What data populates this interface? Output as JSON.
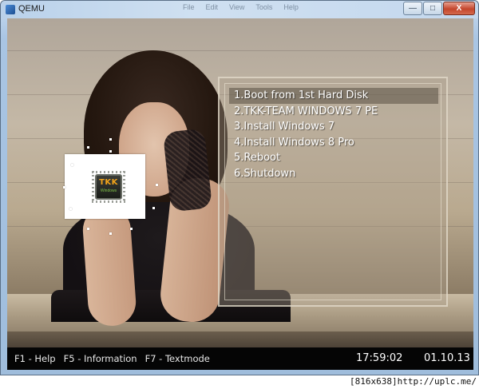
{
  "window": {
    "title": "QEMU",
    "menu_items": [
      "File",
      "Edit",
      "View",
      "Tools",
      "Help"
    ],
    "buttons": {
      "minimize": "—",
      "maximize": "□",
      "close": "X"
    }
  },
  "logo": {
    "text": "TKK",
    "subtext": "Windows"
  },
  "boot_menu": {
    "items": [
      "1.Boot from 1st Hard Disk",
      "2.TKK-TEAM WINDOWS 7 PE",
      "3.Install Windows 7",
      "4.Install Windows 8 Pro",
      "5.Reboot",
      "6.Shutdown"
    ],
    "selected_index": 0
  },
  "status_bar": {
    "hotkeys": [
      "F1 - Help",
      "F5 - Information",
      "F7 - Textmode"
    ],
    "time": "17:59:02",
    "date": "01.10.13"
  },
  "watermark": "[816x638]http://uplc.me/"
}
